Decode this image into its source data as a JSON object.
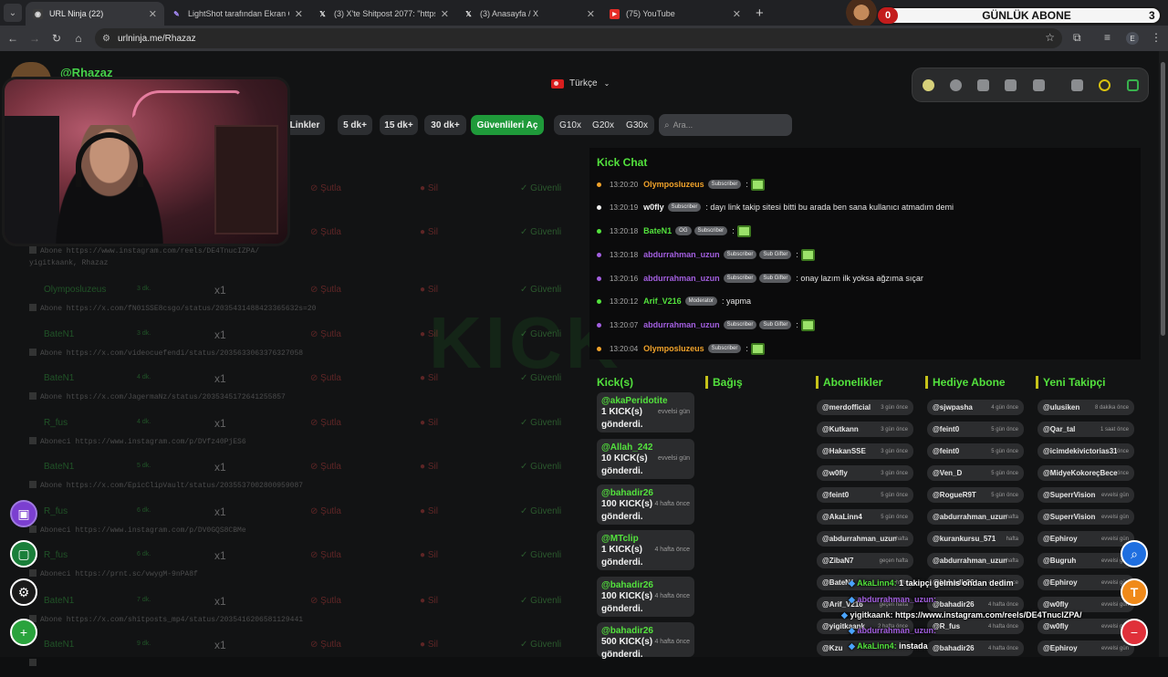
{
  "browser": {
    "tabs": [
      {
        "title": "URL Ninja (22)",
        "active": true,
        "fav": "ninja-icon"
      },
      {
        "title": "LightShot tarafından Ekran Görü",
        "active": false,
        "fav": "feather-icon"
      },
      {
        "title": "(3) X'te Shitpost 2077: \"https://",
        "active": false,
        "fav": "x-icon"
      },
      {
        "title": "(3) Anasayfa / X",
        "active": false,
        "fav": "x-icon"
      },
      {
        "title": "(75) YouTube",
        "active": false,
        "fav": "youtube-icon"
      }
    ],
    "new_tab": "+",
    "url": "urlninja.me/Rhazaz",
    "profile_letter": "E"
  },
  "stream_overlay": {
    "left_count": "0",
    "title": "GÜNLÜK ABONE",
    "right_count": "3"
  },
  "page": {
    "handle": "@Rhazaz",
    "language": "Türkçe",
    "filters": {
      "links": "Linkler",
      "five": "5 dk+",
      "fifteen": "15 dk+",
      "thirty": "30 dk+",
      "trusted": "Güvenlileri Aç",
      "g10": "G10x",
      "g20": "G20x",
      "g30": "G30x",
      "search_placeholder": "Ara..."
    },
    "row_actions": {
      "skip": "Şutla",
      "delete": "Sil",
      "safe": "Güvenli"
    },
    "rows": [
      {
        "user": "",
        "time": "",
        "mult": "",
        "link": ""
      },
      {
        "user": "",
        "time": "",
        "mult": "",
        "link": "Abone https://www.instagram.com/reels/DE4TnucIZPA/",
        "sub": "yigitkaank, Rhazaz"
      },
      {
        "user": "Olymposluzeus",
        "time": "3 dk.",
        "mult": "x1",
        "link": "Abone https://x.com/fN01SSE8csgo/status/2035431488423365632s=20"
      },
      {
        "user": "BateN1",
        "time": "3 dk.",
        "mult": "x1",
        "link": "Abone https://x.com/videocuefendi/status/2035633063376327058"
      },
      {
        "user": "BateN1",
        "time": "4 dk.",
        "mult": "x1",
        "link": "Abone https://x.com/JagermaNz/status/2035345172641255857"
      },
      {
        "user": "R_fus",
        "time": "4 dk.",
        "mult": "x1",
        "link": "Aboneci https://www.instagram.com/p/DVfz40PjES6"
      },
      {
        "user": "BateN1",
        "time": "5 dk.",
        "mult": "x1",
        "link": "Abone https://x.com/EpicClipVault/status/2035537002800959087"
      },
      {
        "user": "R_fus",
        "time": "6 dk.",
        "mult": "x1",
        "link": "Aboneci https://www.instagram.com/p/DV0GQS8CBMe"
      },
      {
        "user": "R_fus",
        "time": "6 dk.",
        "mult": "x1",
        "link": "Aboneci https://prnt.sc/vwygM-9nPA8f"
      },
      {
        "user": "BateN1",
        "time": "7 dk.",
        "mult": "x1",
        "link": "Abone https://x.com/shitposts_mp4/status/2035416206581129441"
      },
      {
        "user": "BateN1",
        "time": "9 dk.",
        "mult": "x1",
        "link": ""
      }
    ],
    "watermark": "KICK"
  },
  "kick_chat": {
    "title": "Kick Chat",
    "messages": [
      {
        "time": "13:20:20",
        "user": "Olymposluzeus",
        "color": "#f0a22a",
        "dot": "#f0a22a",
        "badges": [
          "Subscriber"
        ],
        "text": ":",
        "emote": true
      },
      {
        "time": "13:20:19",
        "user": "w0fly",
        "color": "#f2f2f2",
        "dot": "#f2f2f2",
        "badges": [
          "Subscriber"
        ],
        "text": ": dayı link takip sitesi bitti bu arada ben sana kullanıcı atmadım demi",
        "emote": false
      },
      {
        "time": "13:20:18",
        "user": "BateN1",
        "color": "#53e23d",
        "dot": "#53e23d",
        "badges": [
          "OG",
          "Subscriber"
        ],
        "text": ":",
        "emote": true
      },
      {
        "time": "13:20:18",
        "user": "abdurrahman_uzun",
        "color": "#a35fe0",
        "dot": "#a35fe0",
        "badges": [
          "Subscriber",
          "Sub Gifter"
        ],
        "text": ":",
        "emote": true
      },
      {
        "time": "13:20:16",
        "user": "abdurrahman_uzun",
        "color": "#a35fe0",
        "dot": "#a35fe0",
        "badges": [
          "Subscriber",
          "Sub Gifter"
        ],
        "text": ": onay lazım ilk yoksa ağzıma sıçar",
        "emote": false
      },
      {
        "time": "13:20:12",
        "user": "Arif_V216",
        "color": "#53e23d",
        "dot": "#53e23d",
        "badges": [
          "Moderator"
        ],
        "text": ": yapma",
        "emote": false
      },
      {
        "time": "13:20:07",
        "user": "abdurrahman_uzun",
        "color": "#a35fe0",
        "dot": "#a35fe0",
        "badges": [
          "Subscriber",
          "Sub Gifter"
        ],
        "text": ":",
        "emote": true
      },
      {
        "time": "13:20:04",
        "user": "Olymposluzeus",
        "color": "#f0a22a",
        "dot": "#f0a22a",
        "badges": [
          "Subscriber"
        ],
        "text": ":",
        "emote": true
      }
    ]
  },
  "columns": {
    "kicks_title": "Kick(s)",
    "bagis_title": "Bağış",
    "subs_title": "Abonelikler",
    "gift_title": "Hediye Abone",
    "follow_title": "Yeni Takipçi",
    "kicks": [
      {
        "name": "@akaPeridotite",
        "amount": "1 KICK(s) gönderdi.",
        "ago": "evvelsi gün"
      },
      {
        "name": "@Allah_242",
        "amount": "10 KICK(s) gönderdi.",
        "ago": "evvelsi gün"
      },
      {
        "name": "@bahadir26",
        "amount": "100 KICK(s) gönderdi.",
        "ago": "4 hafta önce"
      },
      {
        "name": "@MTclip",
        "amount": "1 KICK(s) gönderdi.",
        "ago": "4 hafta önce"
      },
      {
        "name": "@bahadir26",
        "amount": "100 KICK(s) gönderdi.",
        "ago": "4 hafta önce"
      },
      {
        "name": "@bahadir26",
        "amount": "500 KICK(s) gönderdi.",
        "ago": "4 hafta önce"
      }
    ],
    "subs": [
      {
        "n": "@merdofficial",
        "a": "3 gün önce"
      },
      {
        "n": "@Kutkann",
        "a": "3 gün önce"
      },
      {
        "n": "@HakanSSE",
        "a": "3 gün önce"
      },
      {
        "n": "@w0fly",
        "a": "3 gün önce"
      },
      {
        "n": "@feint0",
        "a": "5 gün önce"
      },
      {
        "n": "@AkaLinn4",
        "a": "5 gün önce"
      },
      {
        "n": "@abdurrahman_uzun",
        "a": "hafta"
      },
      {
        "n": "@ZibaN7",
        "a": "geçen hafta"
      },
      {
        "n": "@BateN1",
        "a": "hafta"
      },
      {
        "n": "@Arif_V216",
        "a": "geçen hafta"
      },
      {
        "n": "@yigitkaank",
        "a": "2 hafta önce"
      },
      {
        "n": "@Kzu",
        "a": ""
      }
    ],
    "gifts": [
      {
        "n": "@sjwpasha",
        "a": "4 gün önce"
      },
      {
        "n": "@feint0",
        "a": "5 gün önce"
      },
      {
        "n": "@feint0",
        "a": "5 gün önce"
      },
      {
        "n": "@Ven_D",
        "a": "5 gün önce"
      },
      {
        "n": "@RogueR9T",
        "a": "5 gün önce"
      },
      {
        "n": "@abdurrahman_uzun",
        "a": "hafta"
      },
      {
        "n": "@kurankursu_571",
        "a": "hafta"
      },
      {
        "n": "@abdurrahman_uzun",
        "a": "hafta"
      },
      {
        "n": "@bahadir26",
        "a": "4 hafta önce"
      },
      {
        "n": "@bahadir26",
        "a": "4 hafta önce"
      },
      {
        "n": "@R_fus",
        "a": "4 hafta önce"
      },
      {
        "n": "@bahadir26",
        "a": "4 hafta önce"
      }
    ],
    "follows": [
      {
        "n": "@ulusiken",
        "a": "8 dakika önce"
      },
      {
        "n": "@Qar_tal",
        "a": "1 saat önce"
      },
      {
        "n": "@icimdekivictorias31",
        "a": "önce"
      },
      {
        "n": "@MidyeKokoreçBecegi",
        "a": "önce"
      },
      {
        "n": "@SuperrVision",
        "a": "evvelsi gün"
      },
      {
        "n": "@SuperrVision",
        "a": "evvelsi gün"
      },
      {
        "n": "@Ephiroy",
        "a": "evvelsi gün"
      },
      {
        "n": "@Bugruh",
        "a": "evvelsi gün"
      },
      {
        "n": "@Ephiroy",
        "a": "evvelsi gün"
      },
      {
        "n": "@w0fly",
        "a": "evvelsi gün"
      },
      {
        "n": "@w0fly",
        "a": "evvelsi gün"
      },
      {
        "n": "@Ephiroy",
        "a": "evvelsi gün"
      }
    ]
  },
  "overlay_chat": [
    {
      "user": "AkaLinn4:",
      "text": "1 takipçi gelmis ondan dedim",
      "color": "#53e23d"
    },
    {
      "user": "abdurrahman_uzun:",
      "text": "",
      "color": "#a35fe0"
    },
    {
      "user": "yigitkaank:",
      "text": "https://www.instagram.com/reels/DE4TnucIZPA/",
      "color": "#f2f2f2"
    },
    {
      "user": "abdurrahman_uzun:",
      "text": "",
      "color": "#a35fe0"
    },
    {
      "user": "AkaLinn4:",
      "text": "instada",
      "color": "#53e23d"
    }
  ],
  "colors": {
    "accent": "#53e23d",
    "danger": "#d04040",
    "trusted": "#1f9a3a"
  }
}
